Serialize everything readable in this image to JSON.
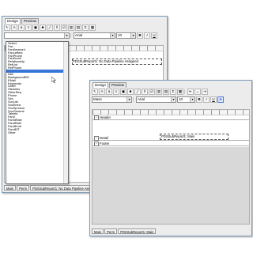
{
  "back_window": {
    "tabs": [
      "Design",
      "Preview"
    ],
    "field_combo": "",
    "font_combo": "Arial",
    "size_combo": "10",
    "report_field": "PDSSubReport1: No Data Pipeline Assigned",
    "status_tabs": [
      "Main",
      "Perm",
      "PDSSubReport1: No Data Pipeline Assigned"
    ]
  },
  "field_list": {
    "items": [
      "Select",
      "Fan",
      "FanKeyword",
      "FanLetters",
      "FanPhone",
      "FanEmail",
      "Relationship",
      "RefList",
      "RefPhone",
      "",
      "Attn",
      "BackgroundEM",
      "EMail",
      "Keywords",
      "Letter",
      "Histories",
      "OtherReq",
      "Phone",
      "Sex",
      "SocList",
      "SocEntra",
      "SocSponsor",
      "SocGeneral",
      "Talents",
      "FanX",
      "FanNRate",
      "FandRate",
      "FandEmit",
      "FandEIT",
      "Other"
    ],
    "selected_index": 9
  },
  "front_window": {
    "tabs": [
      "Design",
      "Preview"
    ],
    "field_combo": "Mass",
    "font_combo": "Arial",
    "size_combo": "10",
    "bands": [
      "Header",
      "Detail",
      "Footer"
    ],
    "report_field": "PDSSubReport1: Main",
    "status_tabs": [
      "Main",
      "Perm",
      "PDSSubReport1: Main"
    ]
  },
  "toolbar_icons": [
    "select-icon",
    "label-icon",
    "text-icon",
    "memo-icon",
    "image-icon",
    "shape-icon",
    "line-icon",
    "barcode-icon",
    "checkbox-icon",
    "chart-icon",
    "subreport-icon",
    "calc-icon",
    "variable-icon"
  ],
  "format_labels": {
    "bold": "B",
    "italic": "I",
    "underline": "U",
    "azure": "A"
  }
}
